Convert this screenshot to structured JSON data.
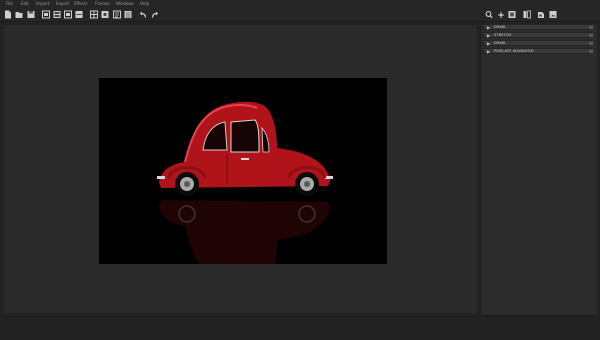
{
  "menu": {
    "items": [
      {
        "label": "File"
      },
      {
        "label": "Edit"
      },
      {
        "label": "Import"
      },
      {
        "label": "Export"
      },
      {
        "label": "Effects"
      },
      {
        "label": "Frames"
      },
      {
        "label": "Windows"
      },
      {
        "label": "Help"
      }
    ]
  },
  "toolbar": {
    "tools": [
      {
        "icon": "new-file-icon"
      },
      {
        "icon": "open-folder-icon"
      },
      {
        "icon": "save-icon"
      },
      {
        "icon": "export-icon"
      },
      {
        "icon": "layers-icon"
      },
      {
        "icon": "frame-icon"
      },
      {
        "icon": "crop-icon"
      },
      {
        "icon": "grid-icon"
      },
      {
        "icon": "transform-icon"
      },
      {
        "icon": "properties-icon"
      },
      {
        "icon": "list-icon"
      },
      {
        "icon": "undo-icon"
      },
      {
        "icon": "redo-icon"
      },
      {
        "icon": "zoom-icon"
      },
      {
        "icon": "pan-icon"
      },
      {
        "icon": "fit-icon"
      },
      {
        "icon": "compare-icon"
      },
      {
        "icon": "settings-icon"
      },
      {
        "icon": "render-icon"
      }
    ]
  },
  "sidebar": {
    "panels": [
      {
        "label": "DRAW"
      },
      {
        "label": "STRETCH"
      },
      {
        "label": "DRAW"
      },
      {
        "label": "PIXELATE ADVANCED"
      }
    ]
  },
  "colors": {
    "background": "#232323",
    "canvas": "#2a2a2a",
    "image_background": "#000000",
    "car_body": "#b0141a"
  }
}
